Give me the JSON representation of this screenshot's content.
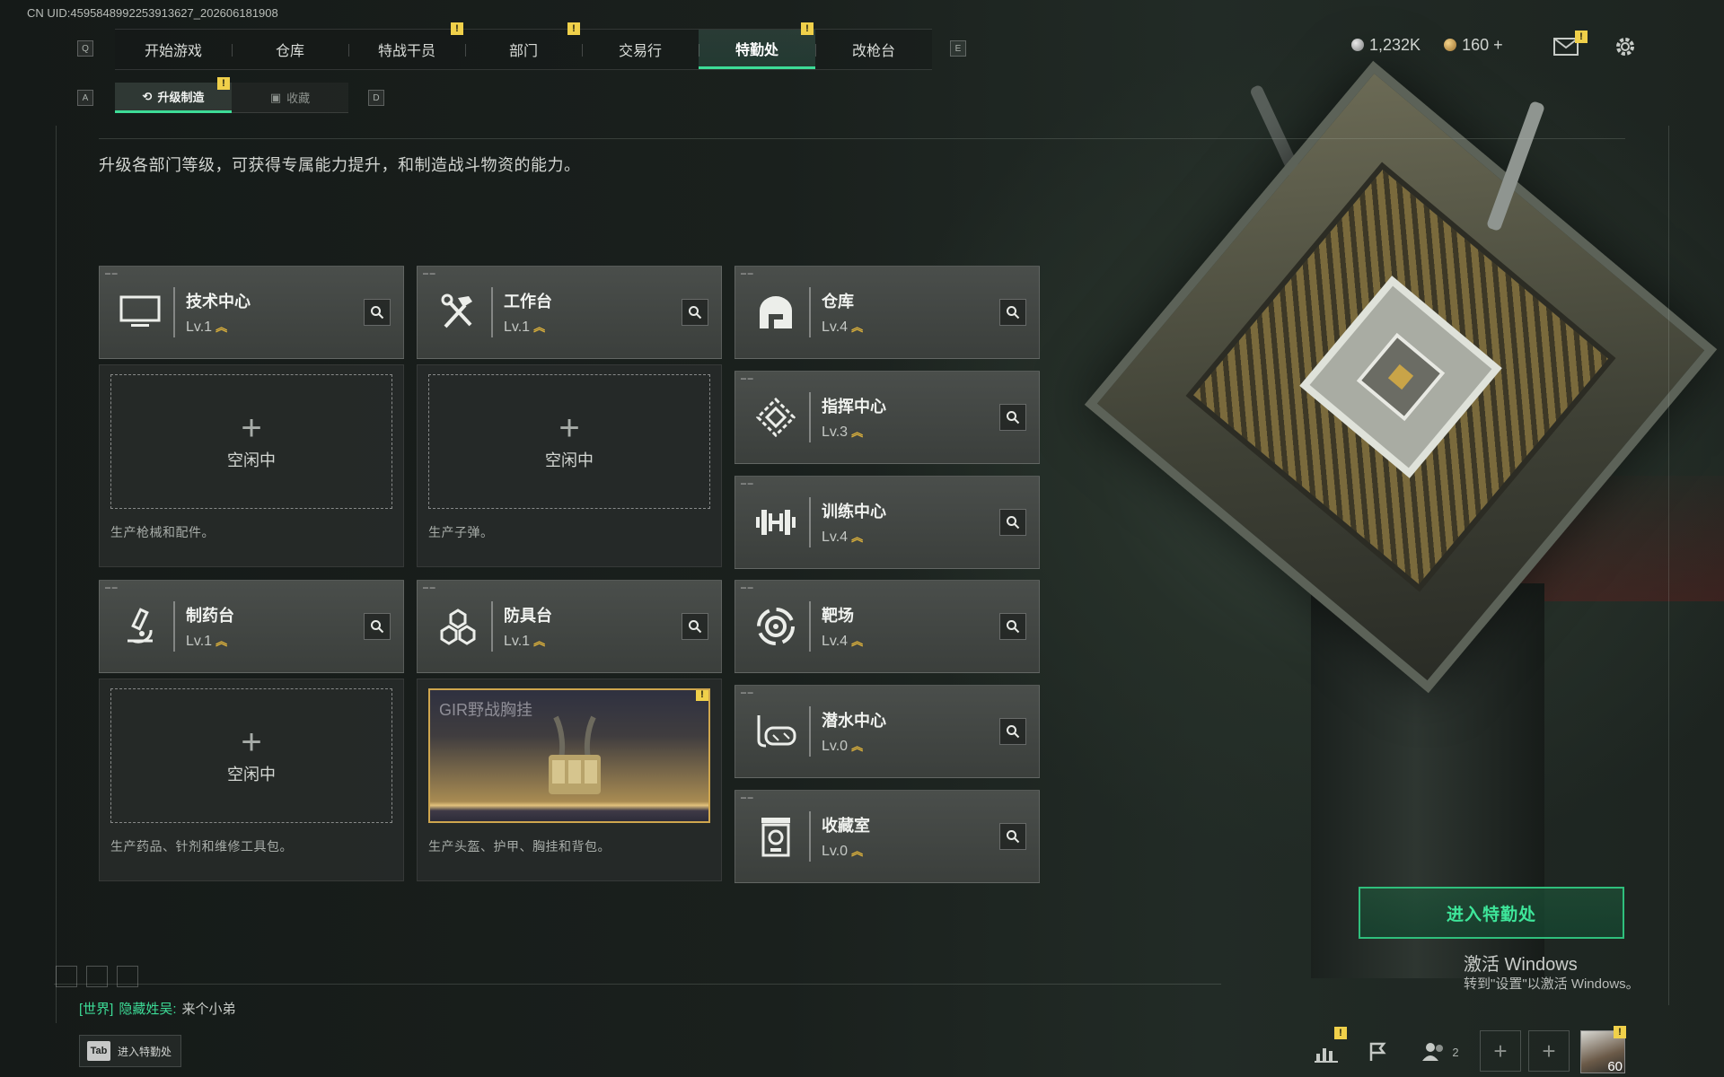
{
  "uid": "CN UID:4595848992253913627_202606181908",
  "colors": {
    "accent": "#3ddc97",
    "alert": "#f0d04a",
    "level_chevron": "#e0b43c",
    "product_border": "#cfa64e"
  },
  "nav": {
    "left_key": "Q",
    "right_key": "E",
    "tabs": [
      {
        "label": "开始游戏",
        "alert": false,
        "active": false
      },
      {
        "label": "仓库",
        "alert": false,
        "active": false
      },
      {
        "label": "特战干员",
        "alert": true,
        "active": false
      },
      {
        "label": "部门",
        "alert": true,
        "active": false
      },
      {
        "label": "交易行",
        "alert": false,
        "active": false
      },
      {
        "label": "特勤处",
        "alert": true,
        "active": true
      },
      {
        "label": "改枪台",
        "alert": false,
        "active": false
      }
    ]
  },
  "currency": {
    "silver": "1,232K",
    "gold": "160",
    "gold_add": "+"
  },
  "subnav": {
    "left_key": "A",
    "right_key": "D",
    "tabs": [
      {
        "label": "升级制造",
        "icon": "upgrade-icon",
        "active": true,
        "alert": true
      },
      {
        "label": "收藏",
        "icon": "collection-icon",
        "active": false,
        "alert": false
      }
    ]
  },
  "alert_mark": "!",
  "description": "升级各部门等级，可获得专属能力提升，和制造战斗物资的能力。",
  "departments": [
    {
      "name": "技术中心",
      "level": "Lv.1",
      "icon": "monitor-icon"
    },
    {
      "name": "工作台",
      "level": "Lv.1",
      "icon": "tools-icon"
    },
    {
      "name": "仓库",
      "level": "Lv.4",
      "icon": "warehouse-icon"
    },
    {
      "name": "指挥中心",
      "level": "Lv.3",
      "icon": "command-icon"
    },
    {
      "name": "训练中心",
      "level": "Lv.4",
      "icon": "dumbbell-icon"
    },
    {
      "name": "制药台",
      "level": "Lv.1",
      "icon": "microscope-icon"
    },
    {
      "name": "防具台",
      "level": "Lv.1",
      "icon": "armor-icon"
    },
    {
      "name": "靶场",
      "level": "Lv.4",
      "icon": "target-icon"
    },
    {
      "name": "潜水中心",
      "level": "Lv.0",
      "icon": "dive-mask-icon"
    },
    {
      "name": "收藏室",
      "level": "Lv.0",
      "icon": "collection-room-icon"
    }
  ],
  "production": [
    {
      "idle_label": "空闲中",
      "plus": "+",
      "desc": "生产枪械和配件。"
    },
    {
      "idle_label": "空闲中",
      "plus": "+",
      "desc": "生产子弹。"
    },
    {
      "idle_label": "空闲中",
      "plus": "+",
      "desc": "生产药品、针剂和维修工具包。"
    },
    {
      "product": "GIR野战胸挂",
      "desc": "生产头盔、护甲、胸挂和背包。"
    }
  ],
  "chat": {
    "channel": "[世界]",
    "sender": "隐藏姓吴:",
    "message": "来个小弟"
  },
  "tab_hint": {
    "key": "Tab",
    "label": "进入特勤处"
  },
  "enter_button": "进入特勤处",
  "windows": {
    "title": "激活 Windows",
    "subtitle": "转到\"设置\"以激活 Windows。"
  },
  "bottom_bar": {
    "squad_count": "2",
    "player_level": "60"
  }
}
